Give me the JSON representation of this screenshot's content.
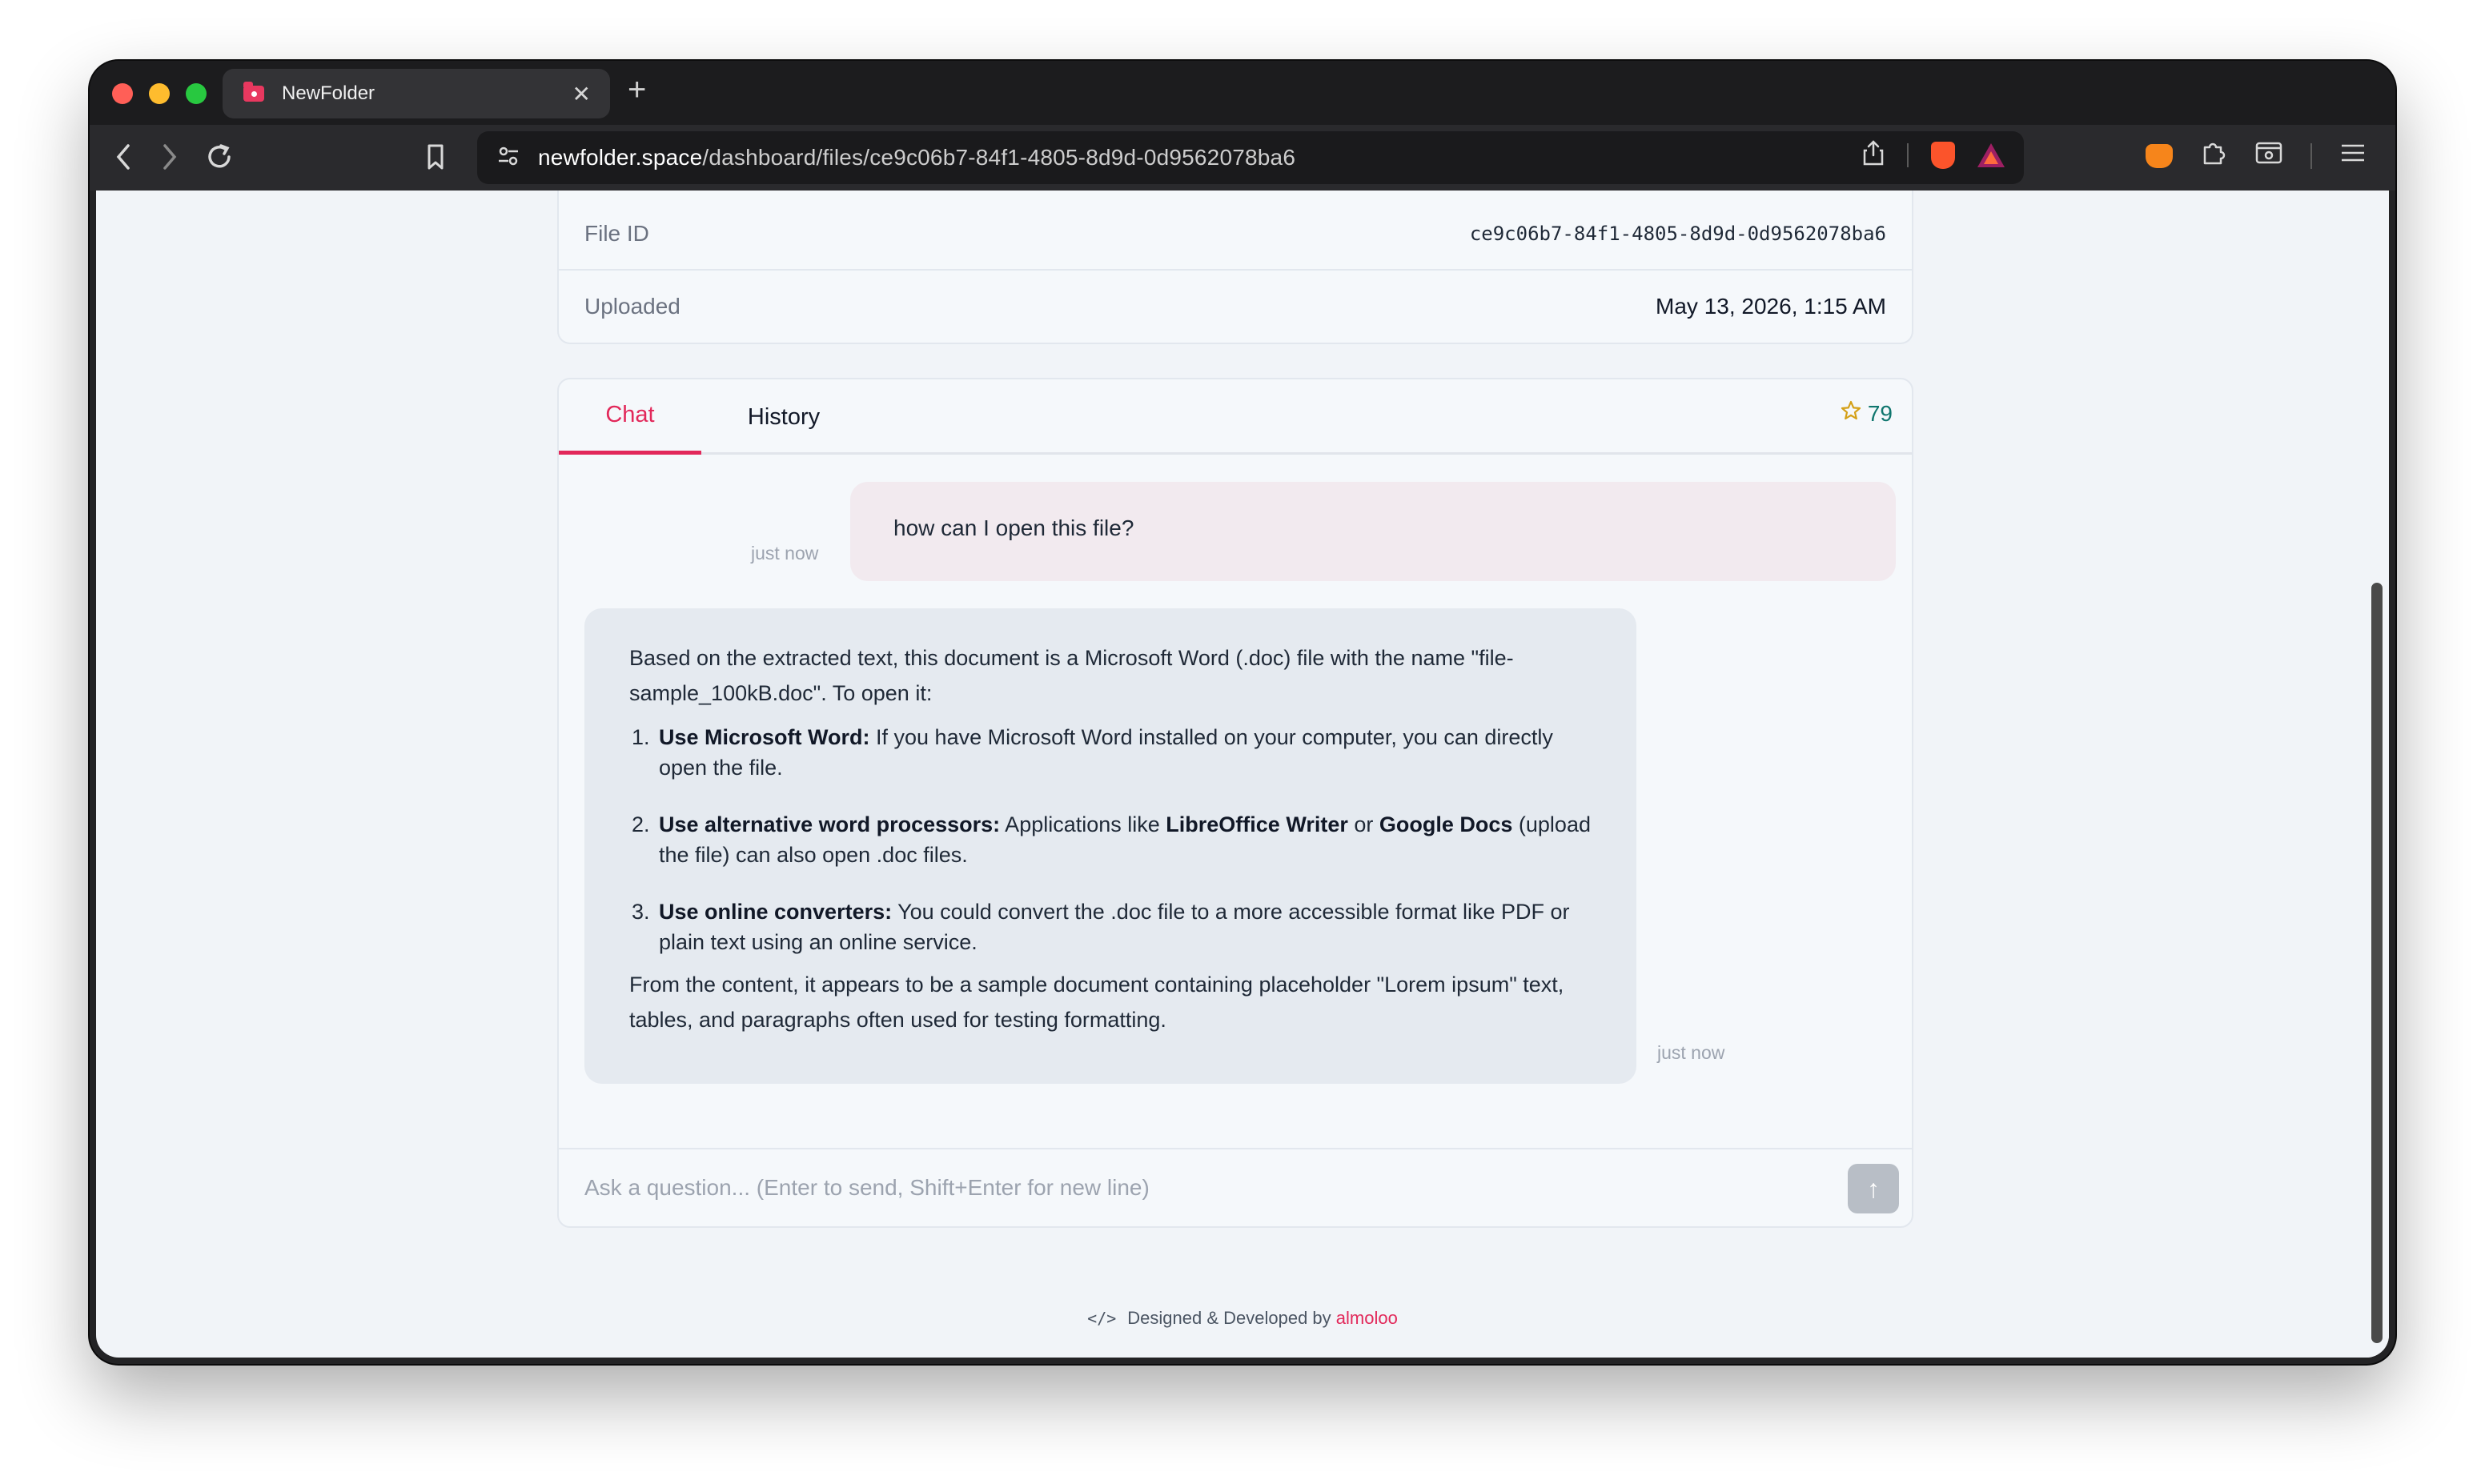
{
  "browser": {
    "tab_title": "NewFolder",
    "tab_close": "✕",
    "new_tab": "+",
    "url_host": "newfolder.space",
    "url_path": "/dashboard/files/ce9c06b7-84f1-4805-8d9d-0d9562078ba6"
  },
  "info": {
    "file_id_label": "File ID",
    "file_id_value": "ce9c06b7-84f1-4805-8d9d-0d9562078ba6",
    "uploaded_label": "Uploaded",
    "uploaded_value": "May 13, 2026, 1:15 AM"
  },
  "chat": {
    "tabs": [
      {
        "label": "Chat"
      },
      {
        "label": "History"
      }
    ],
    "credits": "79",
    "messages": [
      {
        "role": "user",
        "text": "how can I open this file?",
        "time": "just now"
      },
      {
        "role": "assistant",
        "intro": "Based on the extracted text, this document is a Microsoft Word (.doc) file with the name \"file-sample_100kB.doc\". To open it:",
        "items": [
          {
            "title": "Use Microsoft Word:",
            "text": " If you have Microsoft Word installed on your computer, you can directly open the file."
          },
          {
            "title": "Use alternative word processors:",
            "text_a": " Applications like ",
            "bold_a": "LibreOffice Writer",
            "text_b": " or ",
            "bold_b": "Google Docs",
            "text_c": " (upload the file) can also open .doc files."
          },
          {
            "title": "Use online converters:",
            "text": " You could convert the .doc file to a more accessible format like PDF or plain text using an online service."
          }
        ],
        "outro": "From the content, it appears to be a sample document containing placeholder \"Lorem ipsum\" text, tables, and paragraphs often used for testing formatting.",
        "time": "just now"
      }
    ],
    "input_placeholder": "Ask a question... (Enter to send, Shift+Enter for new line)",
    "send_glyph": "↑"
  },
  "footer": {
    "code_glyph": "</>",
    "text": "Designed & Developed by ",
    "link": "almoloo"
  },
  "colors": {
    "accent": "#e2285a",
    "credits": "#0f766e",
    "page_bg": "#f1f4f8"
  }
}
